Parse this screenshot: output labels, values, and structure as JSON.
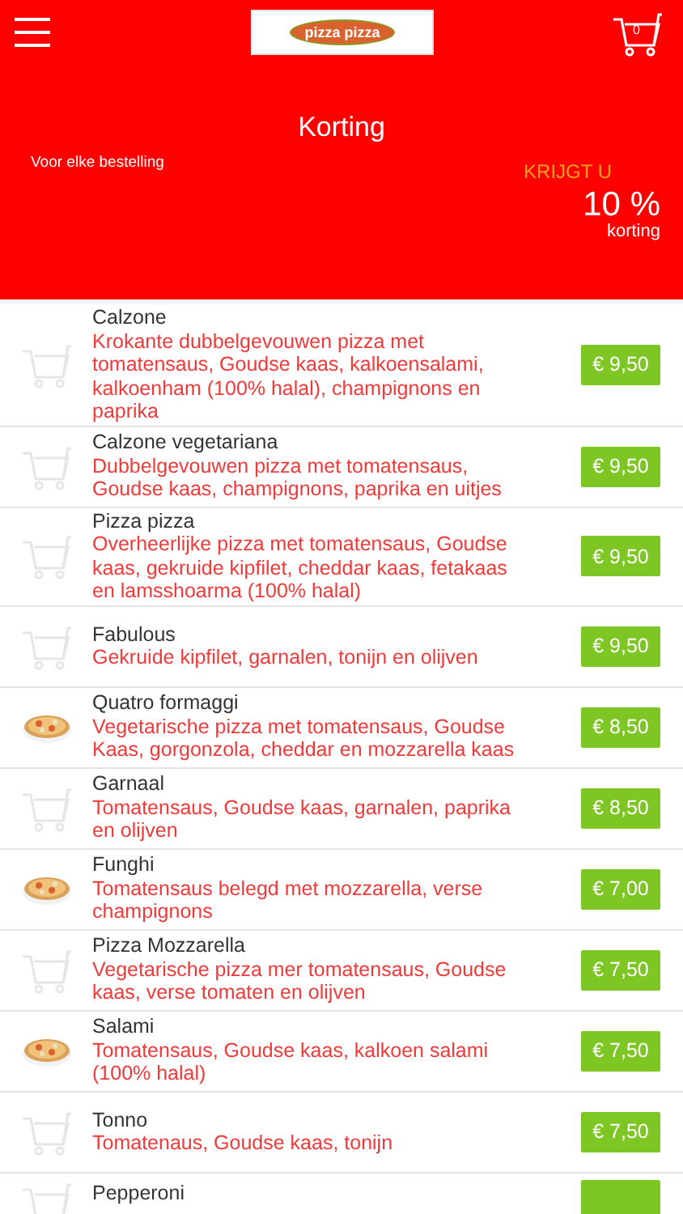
{
  "header": {
    "logo_text": "pizza pizza",
    "cart_count": "0"
  },
  "discount": {
    "title": "Korting",
    "condition": "Voor elke bestelling",
    "label": "KRIJGT U",
    "amount": "10 %",
    "unit": "korting"
  },
  "products": [
    {
      "kind": "cart",
      "name": "Calzone",
      "description": "Krokante dubbelgevouwen pizza met tomatensaus, Goudse kaas, kalkoensalami, kalkoenham (100% halal), champignons en paprika",
      "price": "€ 9,50"
    },
    {
      "kind": "cart",
      "name": "Calzone vegetariana",
      "description": "Dubbelgevouwen pizza met tomatensaus, Goudse kaas, champignons, paprika en uitjes",
      "price": "€ 9,50"
    },
    {
      "kind": "cart",
      "name": "Pizza pizza",
      "description": "Overheerlijke pizza met tomatensaus, Goudse kaas, gekruide kipfilet, cheddar kaas, fetakaas en lamsshoarma (100% halal)",
      "price": "€ 9,50"
    },
    {
      "kind": "cart",
      "name": "Fabulous",
      "description": "Gekruide kipfilet, garnalen, tonijn en olijven",
      "price": "€ 9,50"
    },
    {
      "kind": "picture",
      "name": "Quatro formaggi",
      "description": "Vegetarische pizza met tomatensaus, Goudse Kaas, gorgonzola, cheddar en mozzarella kaas",
      "price": "€ 8,50"
    },
    {
      "kind": "cart",
      "name": "Garnaal",
      "description": "Tomatensaus, Goudse kaas, garnalen, paprika en olijven",
      "price": "€ 8,50"
    },
    {
      "kind": "picture",
      "name": "Funghi",
      "description": "Tomatensaus belegd met mozzarella, verse champignons",
      "price": "€ 7,00"
    },
    {
      "kind": "cart",
      "name": "Pizza Mozzarella",
      "description": "Vegetarische pizza mer tomatensaus, Goudse kaas, verse tomaten en olijven",
      "price": "€ 7,50"
    },
    {
      "kind": "picture",
      "name": "Salami",
      "description": "Tomatensaus, Goudse kaas, kalkoen salami (100% halal)",
      "price": "€ 7,50"
    },
    {
      "kind": "cart",
      "name": "Tonno",
      "description": "Tomatenaus, Goudse kaas, tonijn",
      "price": "€ 7,50"
    },
    {
      "kind": "cart",
      "name": "Pepperoni"
    }
  ]
}
